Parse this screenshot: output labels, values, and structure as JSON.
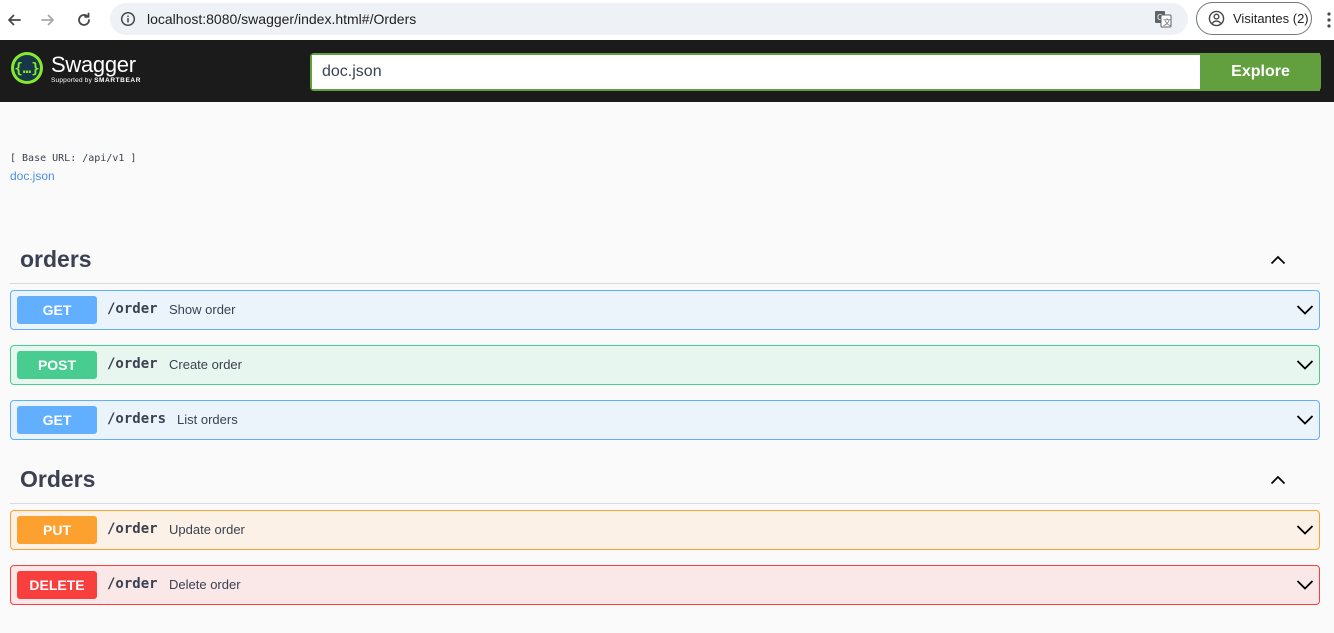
{
  "browser": {
    "url": "localhost:8080/swagger/index.html#/Orders",
    "profile_label": "Visitantes (2)"
  },
  "topbar": {
    "logo_name": "Swagger",
    "logo_sub_prefix": "Supported by ",
    "logo_sub_brand": "SMARTBEAR",
    "search_value": "doc.json",
    "explore_label": "Explore"
  },
  "info": {
    "base_url": "[ Base URL: /api/v1 ]",
    "doc_link": "doc.json"
  },
  "tags": [
    {
      "name": "orders",
      "operations": [
        {
          "method": "GET",
          "path": "/order",
          "summary": "Show order"
        },
        {
          "method": "POST",
          "path": "/order",
          "summary": "Create order"
        },
        {
          "method": "GET",
          "path": "/orders",
          "summary": "List orders"
        }
      ]
    },
    {
      "name": "Orders",
      "operations": [
        {
          "method": "PUT",
          "path": "/order",
          "summary": "Update order"
        },
        {
          "method": "DELETE",
          "path": "/order",
          "summary": "Delete order"
        }
      ]
    }
  ],
  "colors": {
    "get": "#61affe",
    "post": "#49cc90",
    "put": "#fca130",
    "delete": "#f93e3e",
    "explore": "#62a03f",
    "topbar_bg": "#1b1b1b"
  },
  "icons": {
    "back": "arrow-left-icon",
    "forward": "arrow-right-icon",
    "reload": "reload-icon",
    "site_info": "info-icon",
    "translate": "translate-icon",
    "profile": "person-circle-icon",
    "menu": "kebab-menu-icon",
    "logo": "swagger-logo-icon",
    "collapse": "chevron-up-icon",
    "expand": "chevron-down-icon"
  }
}
